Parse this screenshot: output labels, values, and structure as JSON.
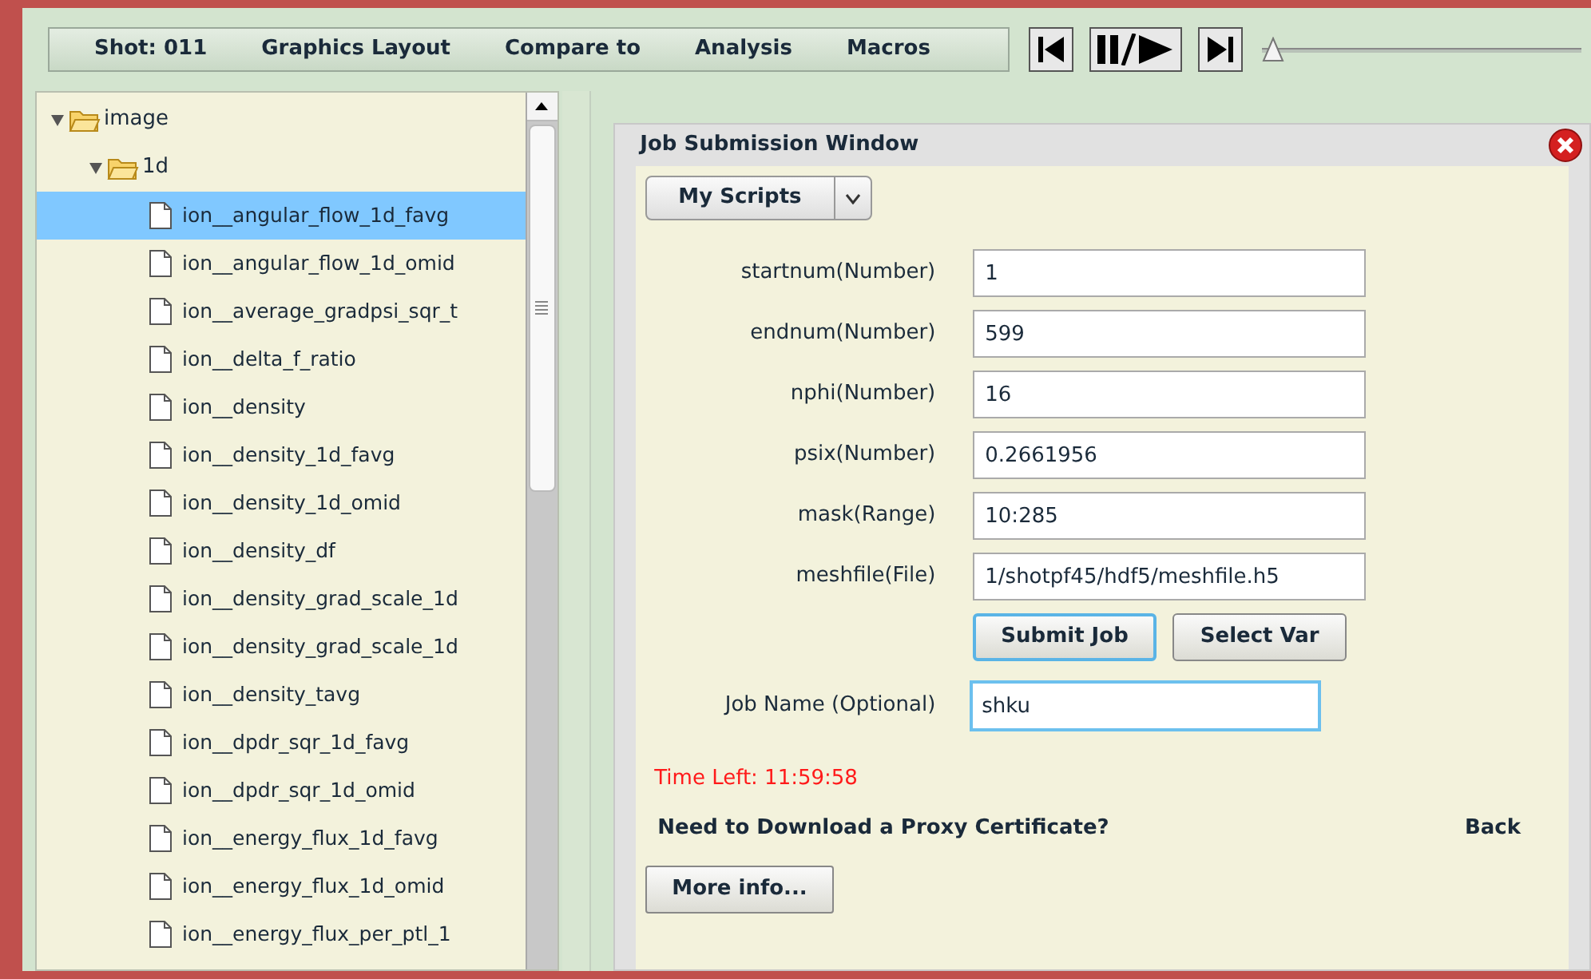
{
  "menu": [
    {
      "label": "Shot: 011"
    },
    {
      "label": "Graphics Layout"
    },
    {
      "label": "Compare to"
    },
    {
      "label": "Analysis"
    },
    {
      "label": "Macros"
    }
  ],
  "player": {
    "level": 0.0
  },
  "tree": [
    {
      "kind": "folder",
      "label": "image",
      "expanded": true,
      "children": [
        {
          "kind": "folder",
          "label": "1d",
          "expanded": true,
          "children": [
            {
              "kind": "file",
              "label": "ion__angular_flow_1d_favg",
              "selected": true
            },
            {
              "kind": "file",
              "label": "ion__angular_flow_1d_omid",
              "selected": false
            },
            {
              "kind": "file",
              "label": "ion__average_gradpsi_sqr_t",
              "selected": false
            },
            {
              "kind": "file",
              "label": "ion__delta_f_ratio",
              "selected": false
            },
            {
              "kind": "file",
              "label": "ion__density",
              "selected": false
            },
            {
              "kind": "file",
              "label": "ion__density_1d_favg",
              "selected": false
            },
            {
              "kind": "file",
              "label": "ion__density_1d_omid",
              "selected": false
            },
            {
              "kind": "file",
              "label": "ion__density_df",
              "selected": false
            },
            {
              "kind": "file",
              "label": "ion__density_grad_scale_1d",
              "selected": false
            },
            {
              "kind": "file",
              "label": "ion__density_grad_scale_1d",
              "selected": false
            },
            {
              "kind": "file",
              "label": "ion__density_tavg",
              "selected": false
            },
            {
              "kind": "file",
              "label": "ion__dpdr_sqr_1d_favg",
              "selected": false
            },
            {
              "kind": "file",
              "label": "ion__dpdr_sqr_1d_omid",
              "selected": false
            },
            {
              "kind": "file",
              "label": "ion__energy_flux_1d_favg",
              "selected": false
            },
            {
              "kind": "file",
              "label": "ion__energy_flux_1d_omid",
              "selected": false
            },
            {
              "kind": "file",
              "label": "ion__energy_flux_per_ptl_1",
              "selected": false
            }
          ]
        }
      ]
    }
  ],
  "dialog": {
    "title": "Job Submission Window",
    "scripts_button": "My Scripts",
    "fields": [
      {
        "label": "startnum(Number)",
        "value": "1"
      },
      {
        "label": "endnum(Number)",
        "value": "599"
      },
      {
        "label": "nphi(Number)",
        "value": "16"
      },
      {
        "label": "psix(Number)",
        "value": "0.2661956"
      },
      {
        "label": "mask(Range)",
        "value": "10:285"
      },
      {
        "label": "meshfile(File)",
        "value": "1/shotpf45/hdf5/meshfile.h5"
      }
    ],
    "buttons": [
      {
        "label": "Submit Job",
        "focused": true
      },
      {
        "label": "Select Var",
        "focused": false
      }
    ],
    "job_name": {
      "label": "Job Name (Optional)",
      "value": "shku"
    },
    "time_left": "Time Left: 11:59:58",
    "proxy_link": "Need to Download a Proxy Certificate?",
    "back_link": "Back",
    "more_button": "More info..."
  }
}
